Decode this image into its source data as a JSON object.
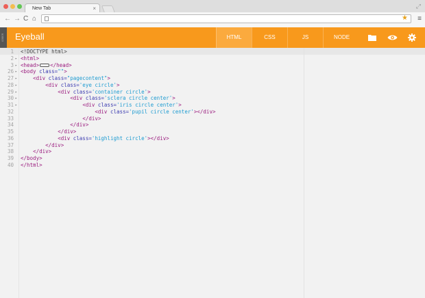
{
  "browser": {
    "tab_title": "New Tab",
    "tab_close": "×",
    "back": "←",
    "forward": "→",
    "reload": "C",
    "home": "⌂",
    "star": "★",
    "menu": "≡",
    "resize": "⤢"
  },
  "app": {
    "vertical_label": "CODER",
    "title": "Eyeball",
    "tabs": [
      {
        "label": "HTML",
        "active": true
      },
      {
        "label": "CSS",
        "active": false
      },
      {
        "label": "JS",
        "active": false
      },
      {
        "label": "NODE",
        "active": false
      }
    ],
    "icons": [
      "folder-icon",
      "eye-icon",
      "gear-icon"
    ],
    "accent": "#f8991c",
    "accent_active": "#fbaa3e"
  },
  "editor": {
    "lines": [
      {
        "num": "1",
        "fold": "",
        "tokens": [
          {
            "t": "text",
            "v": "<!DOCTYPE html>"
          }
        ]
      },
      {
        "num": "2",
        "fold": "▸",
        "tokens": [
          {
            "t": "tag",
            "v": "<html>"
          }
        ]
      },
      {
        "num": "3",
        "fold": "▸",
        "tokens": [
          {
            "t": "tag",
            "v": "<head>"
          },
          {
            "t": "marker",
            "v": ""
          },
          {
            "t": "tag",
            "v": "</head>"
          }
        ]
      },
      {
        "num": "26",
        "fold": "▸",
        "tokens": [
          {
            "t": "tag",
            "v": "<body "
          },
          {
            "t": "attr",
            "v": "class="
          },
          {
            "t": "str",
            "v": "\"\""
          },
          {
            "t": "tag",
            "v": ">"
          }
        ]
      },
      {
        "num": "27",
        "fold": "▸",
        "tokens": [
          {
            "t": "text",
            "v": "    "
          },
          {
            "t": "tag",
            "v": "<div "
          },
          {
            "t": "attr",
            "v": "class="
          },
          {
            "t": "str",
            "v": "\"pagecontent\""
          },
          {
            "t": "tag",
            "v": ">"
          }
        ]
      },
      {
        "num": "28",
        "fold": "▸",
        "tokens": [
          {
            "t": "text",
            "v": "        "
          },
          {
            "t": "tag",
            "v": "<div "
          },
          {
            "t": "attr",
            "v": "class="
          },
          {
            "t": "str",
            "v": "'eye circle'"
          },
          {
            "t": "tag",
            "v": ">"
          }
        ]
      },
      {
        "num": "29",
        "fold": "▸",
        "tokens": [
          {
            "t": "text",
            "v": "            "
          },
          {
            "t": "tag",
            "v": "<div "
          },
          {
            "t": "attr",
            "v": "class="
          },
          {
            "t": "str",
            "v": "'container circle'"
          },
          {
            "t": "tag",
            "v": ">"
          }
        ]
      },
      {
        "num": "30",
        "fold": "▸",
        "tokens": [
          {
            "t": "text",
            "v": "                "
          },
          {
            "t": "tag",
            "v": "<div "
          },
          {
            "t": "attr",
            "v": "class="
          },
          {
            "t": "str",
            "v": "'sclera circle center'"
          },
          {
            "t": "tag",
            "v": ">"
          }
        ]
      },
      {
        "num": "31",
        "fold": "▸",
        "tokens": [
          {
            "t": "text",
            "v": "                    "
          },
          {
            "t": "tag",
            "v": "<div "
          },
          {
            "t": "attr",
            "v": "class="
          },
          {
            "t": "str",
            "v": "'iris circle center'"
          },
          {
            "t": "tag",
            "v": ">"
          }
        ]
      },
      {
        "num": "32",
        "fold": "",
        "tokens": [
          {
            "t": "text",
            "v": "                        "
          },
          {
            "t": "tag",
            "v": "<div "
          },
          {
            "t": "attr",
            "v": "class="
          },
          {
            "t": "str",
            "v": "'pupil circle center'"
          },
          {
            "t": "tag",
            "v": "></div>"
          }
        ]
      },
      {
        "num": "33",
        "fold": "",
        "tokens": [
          {
            "t": "text",
            "v": "                    "
          },
          {
            "t": "tag",
            "v": "</div>"
          }
        ]
      },
      {
        "num": "34",
        "fold": "",
        "tokens": [
          {
            "t": "text",
            "v": "                "
          },
          {
            "t": "tag",
            "v": "</div>"
          }
        ]
      },
      {
        "num": "35",
        "fold": "",
        "tokens": [
          {
            "t": "text",
            "v": "            "
          },
          {
            "t": "tag",
            "v": "</div>"
          }
        ]
      },
      {
        "num": "36",
        "fold": "",
        "tokens": [
          {
            "t": "text",
            "v": "            "
          },
          {
            "t": "tag",
            "v": "<div "
          },
          {
            "t": "attr",
            "v": "class="
          },
          {
            "t": "str",
            "v": "'highlight circle'"
          },
          {
            "t": "tag",
            "v": "></div>"
          }
        ]
      },
      {
        "num": "37",
        "fold": "",
        "tokens": [
          {
            "t": "text",
            "v": "        "
          },
          {
            "t": "tag",
            "v": "</div>"
          }
        ]
      },
      {
        "num": "38",
        "fold": "",
        "tokens": [
          {
            "t": "text",
            "v": "    "
          },
          {
            "t": "tag",
            "v": "</div>"
          }
        ]
      },
      {
        "num": "39",
        "fold": "",
        "tokens": [
          {
            "t": "tag",
            "v": "</body>"
          }
        ]
      },
      {
        "num": "40",
        "fold": "",
        "tokens": [
          {
            "t": "tag",
            "v": "</html>"
          }
        ]
      }
    ]
  }
}
